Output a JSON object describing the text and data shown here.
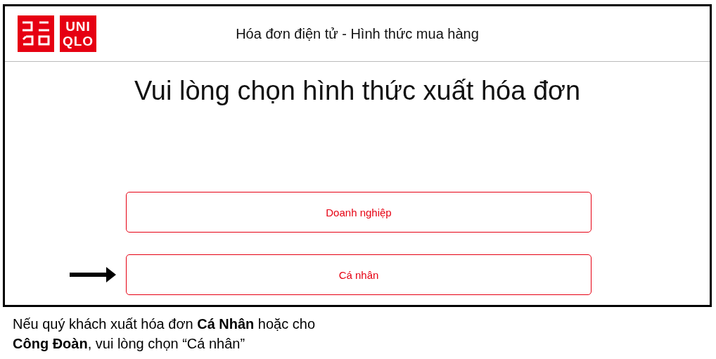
{
  "header": {
    "logo_left": {
      "kind": "katakana"
    },
    "logo_right": {
      "lines": [
        "UNI",
        "QLO"
      ]
    },
    "title": "Hóa đơn điện tử - Hình thức mua hàng"
  },
  "heading": "Vui lòng chọn hình thức xuất hóa đơn",
  "options": [
    {
      "label": "Doanh nghiệp",
      "pointed": false
    },
    {
      "label": "Cá nhân",
      "pointed": true
    }
  ],
  "caption": {
    "lines": [
      "Nếu quý khách xuất hóa đơn **Cá Nhân** hoặc cho",
      "**Công Đoàn**, vui lòng chọn “Cá nhân”"
    ]
  }
}
